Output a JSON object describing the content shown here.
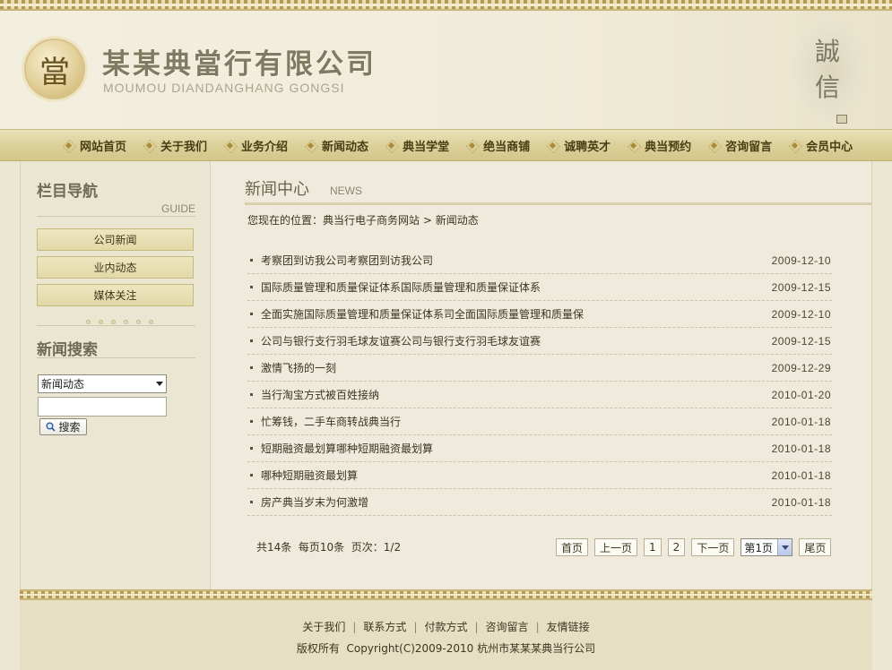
{
  "header": {
    "seal_char": "當",
    "company_name": "某某典當行有限公司",
    "company_pinyin": "MOUMOU DIANDANGHANG GONGSI",
    "motto": "誠信"
  },
  "nav": {
    "items": [
      {
        "label": "网站首页"
      },
      {
        "label": "关于我们"
      },
      {
        "label": "业务介绍"
      },
      {
        "label": "新闻动态"
      },
      {
        "label": "典当学堂"
      },
      {
        "label": "绝当商铺"
      },
      {
        "label": "诚聘英才"
      },
      {
        "label": "典当预约"
      },
      {
        "label": "咨询留言"
      },
      {
        "label": "会员中心"
      }
    ]
  },
  "sidebar": {
    "guide_title": "栏目导航",
    "guide_sub": "GUIDE",
    "categories": [
      {
        "label": "公司新闻"
      },
      {
        "label": "业内动态"
      },
      {
        "label": "媒体关注"
      }
    ],
    "search_title": "新闻搜索",
    "search_select_value": "新闻动态",
    "search_input_value": "",
    "search_button_label": "搜索"
  },
  "main": {
    "title": "新闻中心",
    "title_en": "NEWS",
    "breadcrumb_prefix": "您现在的位置：",
    "breadcrumb_home": "典当行电子商务网站",
    "breadcrumb_sep": " > ",
    "breadcrumb_current": "新闻动态",
    "news": [
      {
        "title": "考察团到访我公司考察团到访我公司",
        "date": "2009-12-10"
      },
      {
        "title": "国际质量管理和质量保证体系国际质量管理和质量保证体系",
        "date": "2009-12-15"
      },
      {
        "title": "全面实施国际质量管理和质量保证体系司全面国际质量管理和质量保",
        "date": "2009-12-10"
      },
      {
        "title": "公司与银行支行羽毛球友谊赛公司与银行支行羽毛球友谊赛",
        "date": "2009-12-15"
      },
      {
        "title": "激情飞扬的一刻",
        "date": "2009-12-29"
      },
      {
        "title": "当行淘宝方式被百姓接纳",
        "date": "2010-01-20"
      },
      {
        "title": "忙筹钱，二手车商转战典当行",
        "date": "2010-01-18"
      },
      {
        "title": "短期融资最划算哪种短期融资最划算",
        "date": "2010-01-18"
      },
      {
        "title": "哪种短期融资最划算",
        "date": "2010-01-18"
      },
      {
        "title": "房产典当岁末为何激增",
        "date": "2010-01-18"
      }
    ],
    "pager": {
      "info": "共14条  每页10条  页次：1/2",
      "first": "首页",
      "prev": "上一页",
      "pages": [
        "1",
        "2"
      ],
      "next": "下一页",
      "select_value": "第1页",
      "last": "尾页"
    }
  },
  "footer": {
    "links": [
      {
        "label": "关于我们"
      },
      {
        "label": "联系方式"
      },
      {
        "label": "付款方式"
      },
      {
        "label": "咨询留言"
      },
      {
        "label": "友情链接"
      }
    ],
    "separator": "|",
    "copyright": "版权所有  Copyright(C)2009-2010 杭州市某某某典当行公司"
  },
  "colors": {
    "accent_gold": "#b39b55",
    "nav_bg": "#dcd19b",
    "page_bg": "#efeadb"
  },
  "icons": {
    "nav_bullet": "diamond-icon",
    "search_button": "magnifier-icon",
    "seal": "seal-logo-icon"
  }
}
